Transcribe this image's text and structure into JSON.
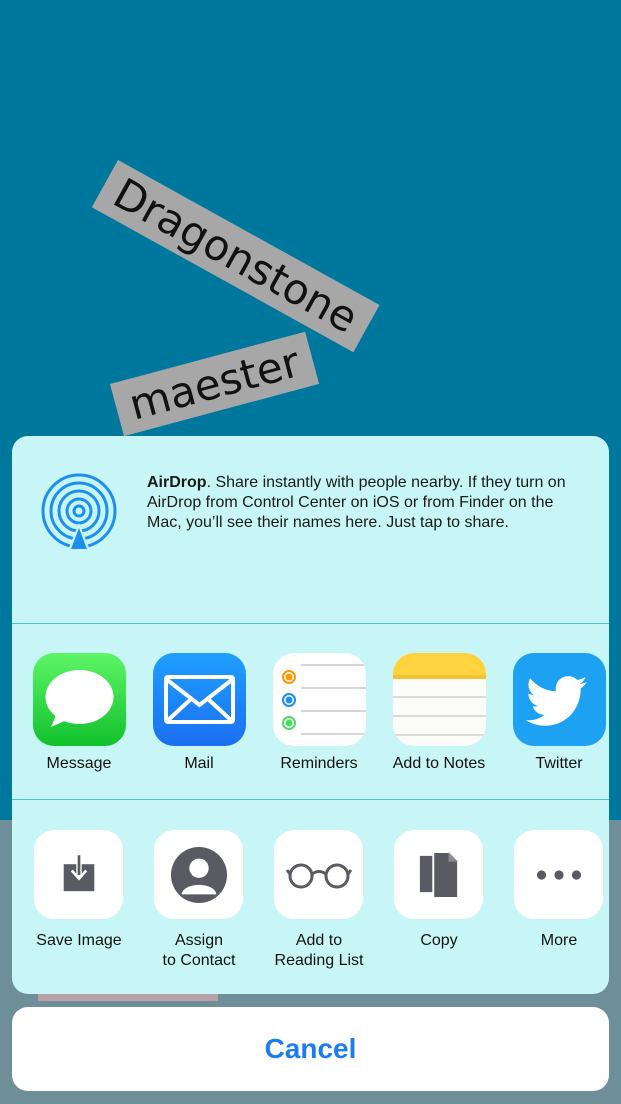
{
  "background": {
    "color": "#00779c",
    "words": [
      "Dragonstone",
      "maester"
    ]
  },
  "airdrop": {
    "title": "AirDrop",
    "description": ". Share instantly with people nearby. If they turn on AirDrop from Control Center on iOS or from Finder on the Mac, you’ll see their names here. Just tap to share.",
    "icon": "airdrop-icon"
  },
  "apps": [
    {
      "label": "Message",
      "icon": "message-icon"
    },
    {
      "label": "Mail",
      "icon": "mail-icon"
    },
    {
      "label": "Reminders",
      "icon": "reminders-icon"
    },
    {
      "label": "Add to Notes",
      "icon": "notes-icon"
    },
    {
      "label": "Twitter",
      "icon": "twitter-icon"
    }
  ],
  "actions": [
    {
      "label": "Save Image",
      "icon": "save-image-icon"
    },
    {
      "label": "Assign\nto Contact",
      "icon": "contact-icon"
    },
    {
      "label": "Add to\nReading List",
      "icon": "reading-list-icon"
    },
    {
      "label": "Copy",
      "icon": "copy-icon"
    },
    {
      "label": "More",
      "icon": "more-icon"
    }
  ],
  "cancel_label": "Cancel",
  "colors": {
    "sheet": "#c8f6f6",
    "accent": "#1d7cf2",
    "divider": "#4cc3cf"
  }
}
